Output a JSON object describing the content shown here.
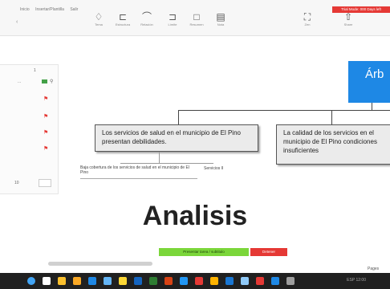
{
  "menu": {
    "tabs": [
      "Inicio",
      "Insertar/Plantilla",
      "Salir"
    ]
  },
  "trial_badge": "Trial Mode: 000 Days left",
  "toolbar": {
    "items": [
      {
        "label": "Tema",
        "icon": "palette-icon"
      },
      {
        "label": "Estructura",
        "icon": "structure-icon"
      },
      {
        "label": "Relación",
        "icon": "relationship-icon"
      },
      {
        "label": "Límite",
        "icon": "boundary-icon"
      },
      {
        "label": "Resumen",
        "icon": "summary-icon"
      },
      {
        "label": "Nota",
        "icon": "note-icon"
      }
    ],
    "right_items": [
      {
        "label": "Zen",
        "icon": "fullscreen-icon"
      },
      {
        "label": "Share",
        "icon": "share-icon"
      }
    ]
  },
  "left_panel": {
    "rows": [
      {
        "label": "1",
        "marker": "1"
      },
      {
        "label": "...",
        "marker": "badge"
      },
      {
        "label": "",
        "marker": "flag"
      },
      {
        "label": "",
        "marker": "flag"
      },
      {
        "label": "",
        "marker": "flag"
      },
      {
        "label": "",
        "marker": "flag"
      }
    ],
    "footer": "10"
  },
  "mindmap": {
    "root": "Árb",
    "node_left": "Los servicios de salud en el municipio de El Pino presentan debilidades.",
    "node_right": "La calidad de los servicios en el municipio de El Pino condiciones insuficientes",
    "sub_left": "Baja cobertura de los servicios de salud en el municipio de El Pino",
    "sub_right": "Servicios II"
  },
  "title": "Analisis",
  "green_bar": "Presentar tarea / subtitulo",
  "red_bar": "Detener",
  "page_label": "Pages",
  "taskbar": {
    "icons": [
      "start-icon",
      "search-icon",
      "chrome-icon",
      "folder-icon",
      "mail-icon",
      "store-icon",
      "app-icon",
      "word-icon",
      "excel-icon",
      "ppt-icon",
      "zoom-icon",
      "mindmap-icon",
      "files-icon",
      "edge-icon",
      "photos-icon",
      "red-app-icon",
      "blue-app-icon",
      "gray-app-icon"
    ],
    "colors": [
      "#42a5f5",
      "#ffffff",
      "#fbc02d",
      "#f9a825",
      "#1e88e5",
      "#64b5f6",
      "#fdd835",
      "#1565c0",
      "#2e7d32",
      "#d84315",
      "#2196f3",
      "#e53935",
      "#ffb300",
      "#1976d2",
      "#90caf9",
      "#e53935",
      "#1e88e5",
      "#9e9e9e"
    ],
    "tray": "ESP 12:00"
  }
}
